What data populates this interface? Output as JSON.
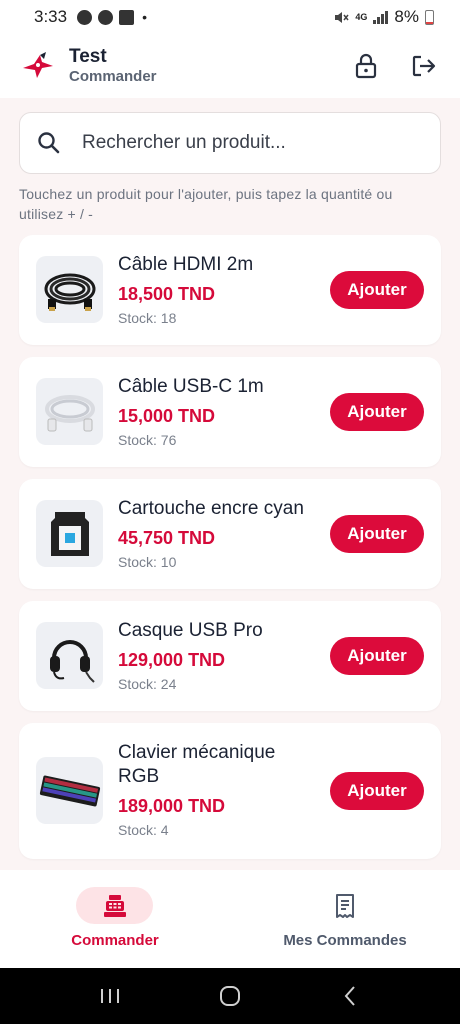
{
  "status_bar": {
    "time": "3:33",
    "dot": "•",
    "network": "4G",
    "battery": "8%"
  },
  "header": {
    "title": "Test",
    "subtitle": "Commander",
    "lock_icon": "lock-icon",
    "logout_icon": "logout-icon"
  },
  "search": {
    "value": "",
    "placeholder": "Rechercher un produit..."
  },
  "hint": "Touchez un produit pour l'ajouter, puis tapez la quantité ou utilisez + / -",
  "products": [
    {
      "name": "Câble HDMI 2m",
      "price": "18,500 TND",
      "stock": "Stock: 18",
      "button": "Ajouter"
    },
    {
      "name": "Câble USB-C 1m",
      "price": "15,000 TND",
      "stock": "Stock: 76",
      "button": "Ajouter"
    },
    {
      "name": "Cartouche encre cyan",
      "price": "45,750 TND",
      "stock": "Stock: 10",
      "button": "Ajouter"
    },
    {
      "name": "Casque USB Pro",
      "price": "129,000 TND",
      "stock": "Stock: 24",
      "button": "Ajouter"
    },
    {
      "name": "Clavier mécanique RGB",
      "price": "189,000 TND",
      "stock": "Stock: 4",
      "button": "Ajouter"
    }
  ],
  "bottom_nav": {
    "tabs": [
      {
        "label": "Commander",
        "icon": "cash-register-icon",
        "active": true
      },
      {
        "label": "Mes Commandes",
        "icon": "receipt-icon",
        "active": false
      }
    ]
  },
  "colors": {
    "accent": "#dc0b3b",
    "price": "#d50a3a",
    "background": "#fbf4f4",
    "active_pill": "#fde3e6"
  }
}
